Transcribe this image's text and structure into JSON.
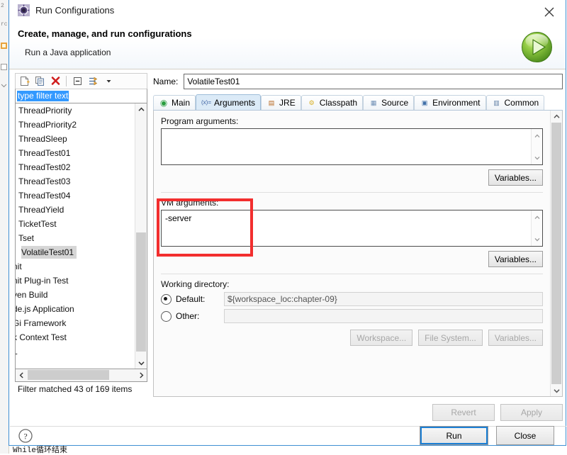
{
  "background": {
    "console_text": "While循环结束",
    "gutter_numbers": [
      "2",
      "rc"
    ]
  },
  "dialog": {
    "title": "Run Configurations",
    "title_icon": "run-configurations-icon",
    "close_icon": "close-icon",
    "heading": "Create, manage, and run configurations",
    "subheading": "Run a Java application",
    "banner_icon": "green-run-play-icon"
  },
  "tree_toolbar": {
    "buttons": [
      {
        "name": "new-configuration",
        "icon": "new-document-icon"
      },
      {
        "name": "duplicate-configuration",
        "icon": "copy-icon"
      },
      {
        "name": "delete-configuration",
        "icon": "delete-red-x-icon"
      },
      {
        "name": "collapse-all",
        "icon": "collapse-all-icon"
      },
      {
        "name": "filter-configurations",
        "icon": "filter-icon"
      },
      {
        "name": "filter-menu",
        "icon": "chevron-down-icon"
      }
    ]
  },
  "filter": {
    "text": "type filter text",
    "placeholder": "type filter text"
  },
  "tree": {
    "items": [
      {
        "label": "ThreadPriority",
        "selected": false,
        "clipped": false
      },
      {
        "label": "ThreadPriority2",
        "selected": false,
        "clipped": false
      },
      {
        "label": "ThreadSleep",
        "selected": false,
        "clipped": false
      },
      {
        "label": "ThreadTest01",
        "selected": false,
        "clipped": false
      },
      {
        "label": "ThreadTest02",
        "selected": false,
        "clipped": false
      },
      {
        "label": "ThreadTest03",
        "selected": false,
        "clipped": false
      },
      {
        "label": "ThreadTest04",
        "selected": false,
        "clipped": false
      },
      {
        "label": "ThreadYield",
        "selected": false,
        "clipped": false
      },
      {
        "label": "TicketTest",
        "selected": false,
        "clipped": false
      },
      {
        "label": "Tset",
        "selected": false,
        "clipped": false
      },
      {
        "label": "VolatileTest01",
        "selected": true,
        "clipped": false
      },
      {
        "label": "nit",
        "selected": false,
        "clipped": true
      },
      {
        "label": "nit Plug-in Test",
        "selected": false,
        "clipped": true
      },
      {
        "label": "ven Build",
        "selected": false,
        "clipped": true
      },
      {
        "label": "de.js Application",
        "selected": false,
        "clipped": true
      },
      {
        "label": "Gi Framework",
        "selected": false,
        "clipped": true
      },
      {
        "label": "k Context Test",
        "selected": false,
        "clipped": true
      },
      {
        "label": "L",
        "selected": false,
        "clipped": true
      }
    ],
    "status": "Filter matched 43 of 169 items"
  },
  "name_field": {
    "label": "Name:",
    "value": "VolatileTest01",
    "placeholder": ""
  },
  "tabs": [
    {
      "label": "Main",
      "icon": "main-green-circle-icon",
      "glyph": "◉",
      "active": false
    },
    {
      "label": "Arguments",
      "icon": "arguments-variable-icon",
      "glyph": "(x)=",
      "active": true
    },
    {
      "label": "JRE",
      "icon": "jre-icon",
      "glyph": "▤",
      "active": false
    },
    {
      "label": "Classpath",
      "icon": "classpath-icon",
      "glyph": "⚙",
      "active": false
    },
    {
      "label": "Source",
      "icon": "source-icon",
      "glyph": "▦",
      "active": false
    },
    {
      "label": "Environment",
      "icon": "environment-icon",
      "glyph": "▣",
      "active": false
    },
    {
      "label": "Common",
      "icon": "common-icon",
      "glyph": "▥",
      "active": false
    }
  ],
  "program_arguments": {
    "label": "Program arguments:",
    "value": "",
    "variables_button": "Variables..."
  },
  "vm_arguments": {
    "label": "VM arguments:",
    "value": "-server",
    "variables_button": "Variables..."
  },
  "working_directory": {
    "label": "Working directory:",
    "default_label": "Default:",
    "default_value": "${workspace_loc:chapter-09}",
    "default_selected": true,
    "other_label": "Other:",
    "other_value": "",
    "other_selected": false,
    "workspace_button": "Workspace...",
    "filesystem_button": "File System...",
    "variables_button": "Variables..."
  },
  "footer": {
    "revert_button": "Revert",
    "apply_button": "Apply",
    "help_icon": "help-question-icon",
    "run_button": "Run",
    "close_button": "Close"
  },
  "annotation": {
    "color": "#f22e2e",
    "target": "vm-arguments-field"
  }
}
